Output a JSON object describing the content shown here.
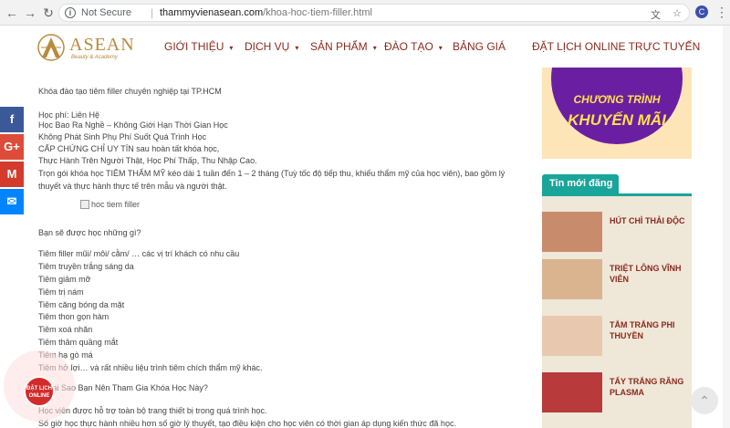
{
  "browser": {
    "back": "←",
    "forward": "→",
    "reload": "↻",
    "security": "Not Secure",
    "url_host": "thammyvienasean.com",
    "url_path": "/khoa-hoc-tiem-filler.html",
    "avatar_letter": "C"
  },
  "site": {
    "logo_text": "ASEAN",
    "logo_sub": "Beauty & Academy",
    "nav": [
      {
        "label": "GIỚI THIỆU",
        "caret": true
      },
      {
        "label": "DỊCH VỤ",
        "caret": true
      },
      {
        "label": "SẢN PHẨM",
        "caret": true
      },
      {
        "label": "ĐÀO TẠO",
        "caret": true
      },
      {
        "label": "BẢNG GIÁ",
        "caret": false
      },
      {
        "label": "ĐẶT LỊCH ONLINE TRỰC TUYẾN",
        "caret": false
      }
    ]
  },
  "share": [
    {
      "icon": "facebook-icon",
      "glyph": "f",
      "color": "#3b5998"
    },
    {
      "icon": "google-plus-icon",
      "glyph": "G+",
      "color": "#dd4b39"
    },
    {
      "icon": "gmail-icon",
      "glyph": "M",
      "color": "#d33b2c"
    },
    {
      "icon": "messenger-icon",
      "glyph": "✉",
      "color": "#0084ff"
    }
  ],
  "article": {
    "lines": [
      "Khóa đào tạo tiêm filler chuyên nghiệp tại TP.HCM",
      "Học phí: Liên Hệ",
      "Học Bao Ra Nghề – Không Giới Hạn Thời Gian Học",
      "Không Phát Sinh Phụ Phí Suốt Quá Trình Học",
      "CẤP CHỨNG CHỈ UY TÍN sau hoàn tất khóa học,",
      "Thực Hành Trên Người Thật, Học Phí Thấp, Thu Nhập Cao.",
      "Trọn gói khóa học TIÊM THẨM MỸ kéo dài 1 tuần đến 1 – 2 tháng (Tuỳ tốc độ tiếp thu, khiếu thẩm mỹ của học viên), bao gồm lý",
      "thuyết và thực hành thực tế trên mẫu và người thật.",
      "Bạn sẽ được học những gì?",
      "Tiêm filler mũi/ môi/ cằm/ … các vị trí khách có nhu cầu",
      "Tiêm truyền trắng sáng da",
      "Tiêm giảm mỡ",
      "Tiêm trị nám",
      "Tiêm căng bóng da mặt",
      "Tiêm thon gọn hàm",
      "Tiêm xoá nhăn",
      "Tiêm thâm quầng mắt",
      "Tiêm hạ gò má",
      "Tiêm hở lợi… và rất nhiều liệu trình tiêm chích thẩm mỹ khác.",
      "Tại Sao Bạn Nên Tham Gia Khóa Học Này?",
      "Học viên được hỗ trợ toàn bộ trang thiết bị trong quá trình học.",
      "Số giờ học thực hành nhiều hơn số giờ lý thuyết, tạo điều kiện cho học viên có thời gian áp dụng kiến thức đã học."
    ],
    "image_alt": "hoc tiem filler"
  },
  "sidebar": {
    "promo_line1": "CHƯƠNG TRÌNH",
    "promo_line2": "KHUYẾN MÃI",
    "news_heading": "Tin mới đăng",
    "news": [
      {
        "title": "HÚT CHÌ THẢI ĐỘC",
        "thumb": "#c88c6c"
      },
      {
        "title": "TRIỆT LÔNG VĨNH VIỄN",
        "thumb": "#d9b48f"
      },
      {
        "title": "TẮM TRẮNG PHI THUYỀN",
        "thumb": "#e8c9b0"
      },
      {
        "title": "TẨY TRẮNG RĂNG PLASMA",
        "thumb": "#b83a3a"
      }
    ]
  },
  "badge": {
    "line1": "ĐẶT LỊCH",
    "line2": "ONLINE"
  },
  "colors": {
    "brand": "#8b2a1e",
    "accent": "#1aa59a",
    "gold": "#b88a3e"
  }
}
